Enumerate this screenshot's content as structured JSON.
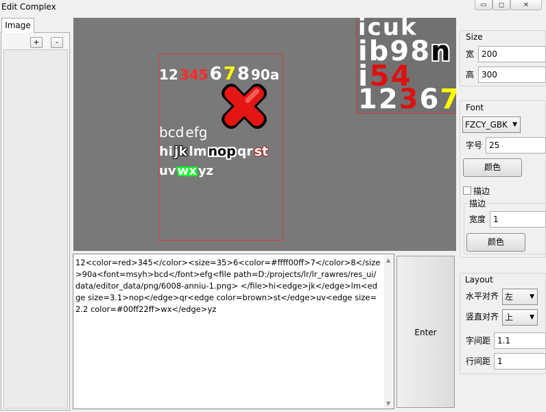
{
  "window": {
    "title": "Edit Complex",
    "minimize_glyph": "▭",
    "restore_glyph": "◻",
    "close_glyph": "✕"
  },
  "left": {
    "tab": "Image",
    "add": "+",
    "remove": "-"
  },
  "canvas": {
    "preview_rows": [
      [
        {
          "t": "i",
          "c": "#ffffff"
        },
        {
          "t": "c",
          "c": "#ffffff"
        },
        {
          "t": "u",
          "c": "#ffffff"
        },
        {
          "t": "k",
          "c": "#ffffff"
        }
      ],
      [
        {
          "t": "i",
          "c": "#ffffff"
        },
        {
          "t": "b",
          "c": "#ffffff"
        },
        {
          "t": "9",
          "c": "#ffffff"
        },
        {
          "t": "8",
          "c": "#ffffff"
        },
        {
          "t": "n",
          "c": "#000000"
        }
      ],
      [
        {
          "t": "i",
          "c": "#ffffff"
        },
        {
          "t": "5",
          "c": "#dd1111"
        },
        {
          "t": "4",
          "c": "#dd1111"
        }
      ],
      [
        {
          "t": "1",
          "c": "#ffffff"
        },
        {
          "t": "2",
          "c": "#ffffff"
        },
        {
          "t": "3",
          "c": "#dd1111"
        },
        {
          "t": "6",
          "c": "#ffffff"
        },
        {
          "t": "7",
          "c": "#ffff00"
        }
      ]
    ],
    "line1": [
      {
        "t": "12",
        "c": "#ffffff"
      },
      {
        "t": "345",
        "c": "#ff2a2a"
      },
      {
        "t": "6",
        "c": "#ffffff"
      },
      {
        "t": "7",
        "c": "#ffff00"
      },
      {
        "t": "8",
        "c": "#ffffff"
      },
      {
        "t": "90a",
        "c": "#ffffff"
      }
    ],
    "line2": [
      {
        "t": "bcd",
        "c": "#ffffff"
      },
      {
        "t": "efg",
        "c": "#ffffff"
      }
    ],
    "line3": [
      {
        "t": "hi",
        "c": "#ffffff"
      },
      {
        "t": "jk",
        "c": "#ffffff"
      },
      {
        "t": "lm",
        "c": "#ffffff"
      },
      {
        "t": "nop",
        "c": "#000000"
      },
      {
        "t": "qr",
        "c": "#ffffff"
      },
      {
        "t": "st",
        "c": "#ffffff"
      }
    ],
    "line4": [
      {
        "t": "uv",
        "c": "#ffffff"
      },
      {
        "t": "wx",
        "c": "#ffffff"
      },
      {
        "t": "yz",
        "c": "#ffffff"
      }
    ]
  },
  "editor": {
    "text": "12<color=red>345</color><size=35>6<color=#ffff00ff>7</color>8</size>90a<font=msyh>bcd</font>efg<file path=D:/projects/lr/lr_rawres/res_ui/data/editor_data/png/6008-anniu-1.png> </file>hi<edge>jk</edge>lm<edge size=3.1>nop</edge>qr<edge color=brown>st</edge>uv<edge size=2.2 color=#00ff22ff>wx</edge>yz",
    "enter": "Enter"
  },
  "size": {
    "title": "Size",
    "width_label": "宽",
    "width": "200",
    "height_label": "高",
    "height": "300"
  },
  "font": {
    "title": "Font",
    "family": "FZCY_GBK",
    "size_label": "字号",
    "size": "25",
    "color_button": "颜色"
  },
  "stroke": {
    "checkbox_label": "描边",
    "title": "描边",
    "width_label": "宽度",
    "width": "1",
    "color_button": "颜色"
  },
  "layout": {
    "title": "Layout",
    "halign_label": "水平对齐",
    "halign": "左",
    "valign_label": "竖直对齐",
    "valign": "上",
    "char_spacing_label": "字间距",
    "char_spacing": "1.1",
    "line_spacing_label": "行间距",
    "line_spacing": "1"
  }
}
